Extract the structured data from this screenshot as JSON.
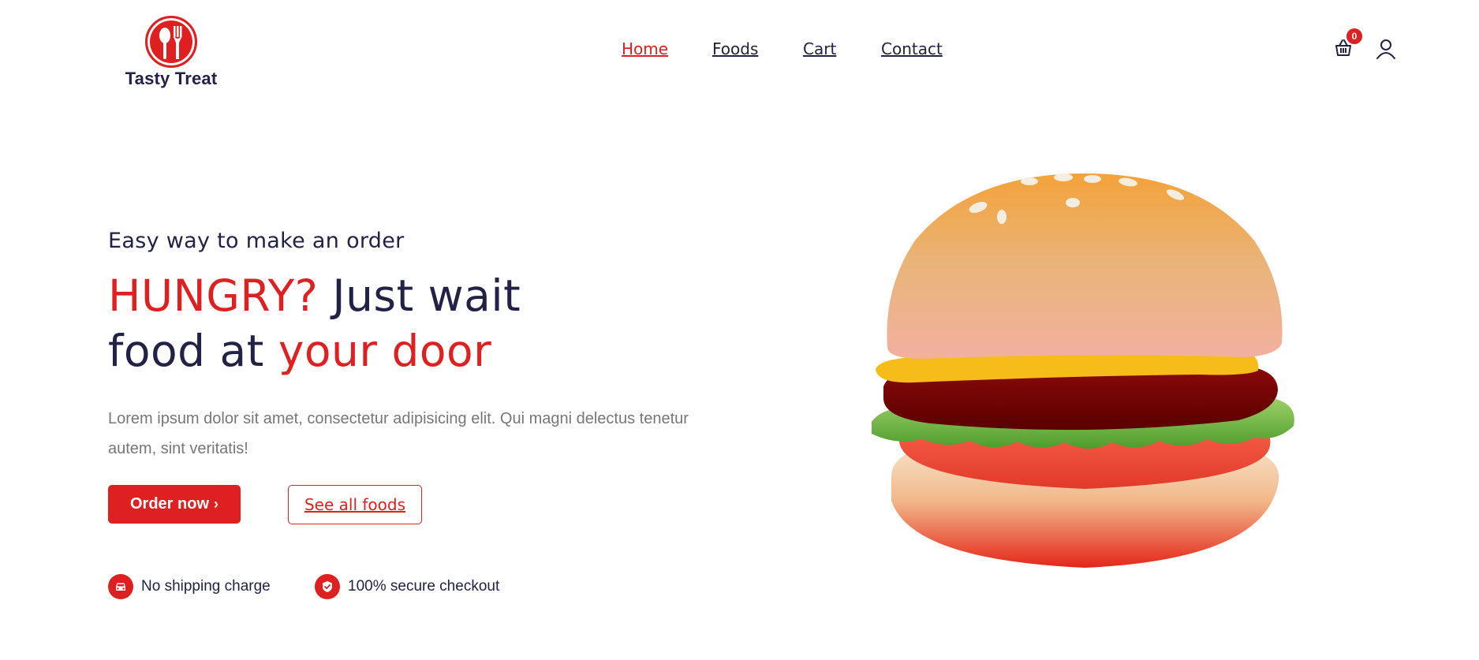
{
  "brand": {
    "name": "Tasty Treat",
    "logo_icon": "spoon-fork-icon",
    "accent_color": "#df2020",
    "text_color": "#212245"
  },
  "nav": {
    "items": [
      {
        "label": "Home",
        "active": true
      },
      {
        "label": "Foods",
        "active": false
      },
      {
        "label": "Cart",
        "active": false
      },
      {
        "label": "Contact",
        "active": false
      }
    ]
  },
  "header_actions": {
    "cart_icon": "shopping-basket-icon",
    "cart_count": "0",
    "user_icon": "user-icon"
  },
  "hero": {
    "subtitle": "Easy way to make an order",
    "headline": {
      "part1": "HUNGRY?",
      "part2": " Just wait",
      "part3": "food at ",
      "part4": "your door"
    },
    "description": "Lorem ipsum dolor sit amet, consectetur adipisicing elit. Qui magni delectus tenetur autem, sint veritatis!",
    "primary_button": {
      "label": "Order now",
      "icon": "chevron-right-icon"
    },
    "secondary_button": {
      "label": "See all foods"
    },
    "features": [
      {
        "icon": "car-icon",
        "label": "No shipping charge"
      },
      {
        "icon": "shield-check-icon",
        "label": "100% secure checkout"
      }
    ],
    "image": "burger-illustration"
  }
}
